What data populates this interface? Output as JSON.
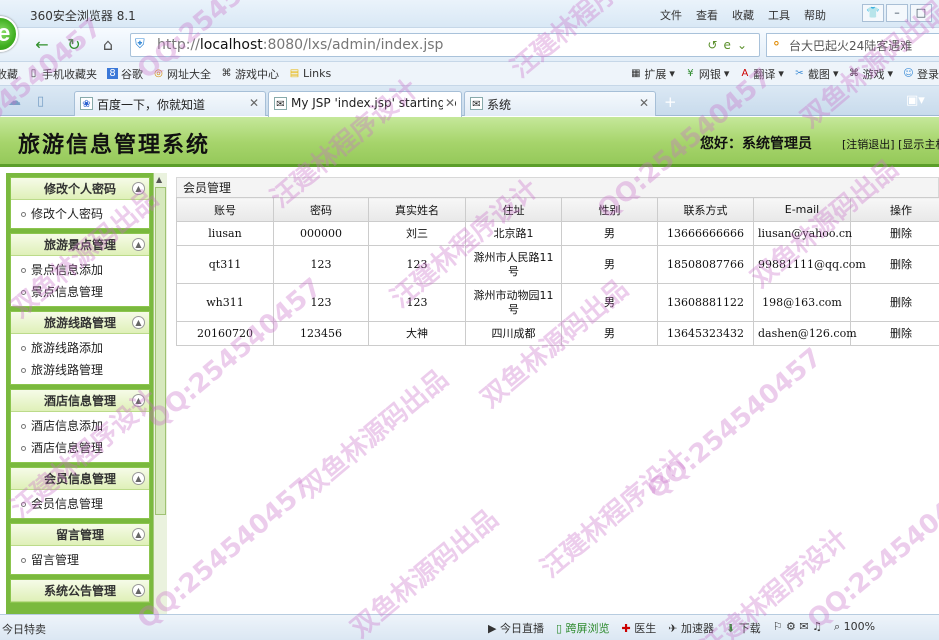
{
  "browser": {
    "title": "360安全浏览器 8.1",
    "menus": [
      "文件",
      "查看",
      "收藏",
      "工具",
      "帮助"
    ],
    "url_prefix": "http://",
    "url_host": "localhost",
    "url_rest": ":8080/lxs/admin/index.jsp",
    "search_value": "台大巴起火24陆客遇难",
    "favorites": [
      "收藏",
      "手机收藏夹",
      "谷歌",
      "网址大全",
      "游戏中心",
      "Links"
    ],
    "right_tools": [
      "扩展",
      "网银",
      "翻译",
      "截图",
      "游戏",
      "登录"
    ],
    "tabs": [
      "百度一下，你就知道",
      "My JSP 'index.jsp' starting p",
      "系统"
    ],
    "status_left": "今日特卖",
    "status_items": [
      "今日直播",
      "跨屏浏览",
      "医生",
      "加速器",
      "下载",
      "100%"
    ]
  },
  "header": {
    "title": "旅游信息管理系统",
    "greeting": "您好：系统管理员",
    "logout": "[注销退出]",
    "show_main": "[显示主机]"
  },
  "sidebar": {
    "groups": [
      {
        "title": "修改个人密码",
        "items": [
          "修改个人密码"
        ]
      },
      {
        "title": "旅游景点管理",
        "items": [
          "景点信息添加",
          "景点信息管理"
        ]
      },
      {
        "title": "旅游线路管理",
        "items": [
          "旅游线路添加",
          "旅游线路管理"
        ]
      },
      {
        "title": "酒店信息管理",
        "items": [
          "酒店信息添加",
          "酒店信息管理"
        ]
      },
      {
        "title": "会员信息管理",
        "items": [
          "会员信息管理"
        ]
      },
      {
        "title": "留言管理",
        "items": [
          "留言管理"
        ]
      },
      {
        "title": "系统公告管理",
        "items": []
      }
    ]
  },
  "content": {
    "box_title": "会员管理",
    "columns": [
      "账号",
      "密码",
      "真实姓名",
      "住址",
      "性别",
      "联系方式",
      "E-mail",
      "操作"
    ],
    "rows": [
      [
        "liusan",
        "000000",
        "刘三",
        "北京路1",
        "男",
        "13666666666",
        "liusan@yahoo.cn",
        "删除"
      ],
      [
        "qt311",
        "123",
        "123",
        "滁州市人民路11号",
        "男",
        "18508087766",
        "99881111@qq.com",
        "删除"
      ],
      [
        "wh311",
        "123",
        "123",
        "滁州市动物园11号",
        "男",
        "13608881122",
        "198@163.com",
        "删除"
      ],
      [
        "20160720",
        "123456",
        "大神",
        "四川成都",
        "男",
        "13645323432",
        "dashen@126.com",
        "删除"
      ]
    ]
  },
  "watermark": {
    "texts": [
      "QQ:254540457",
      "双鱼林源码出品",
      "汪建林程序设计"
    ],
    "color": "#c971c9"
  },
  "colors": {
    "header_green": "#a6d46b",
    "sidebar_green": "#7ab93e",
    "header_border": "#5c9e2a"
  }
}
